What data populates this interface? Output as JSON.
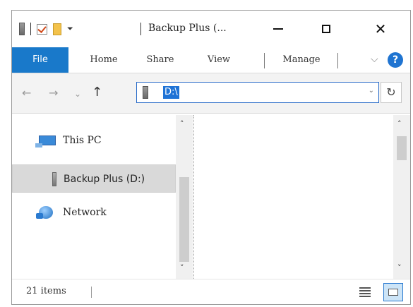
{
  "window": {
    "title": "Backup Plus (..."
  },
  "quick_access": {
    "dropdown_glyph": "⏷"
  },
  "controls": {
    "minimize": "",
    "maximize": "",
    "close": "✕"
  },
  "ribbon": {
    "tabs": [
      "File",
      "Home",
      "Share",
      "View",
      "Manage"
    ],
    "help": "?",
    "collapse_glyph": "⌵",
    "accent_color": "#1979ca"
  },
  "navigation": {
    "back": "←",
    "forward": "→",
    "recent": "⌄",
    "up": "↑",
    "address": "D:\\",
    "address_dropdown": "⌄",
    "refresh": "↻"
  },
  "nav_pane": {
    "items": [
      {
        "label": "This PC",
        "icon": "computer-icon"
      },
      {
        "label": "Backup Plus (D:)",
        "icon": "drive-icon",
        "selected": true
      },
      {
        "label": "Network",
        "icon": "network-icon"
      }
    ],
    "scroll_up": "˄",
    "scroll_down": "˅"
  },
  "content_pane": {
    "scroll_up": "˄",
    "scroll_down": "˅"
  },
  "status_bar": {
    "item_count": "21 items"
  }
}
